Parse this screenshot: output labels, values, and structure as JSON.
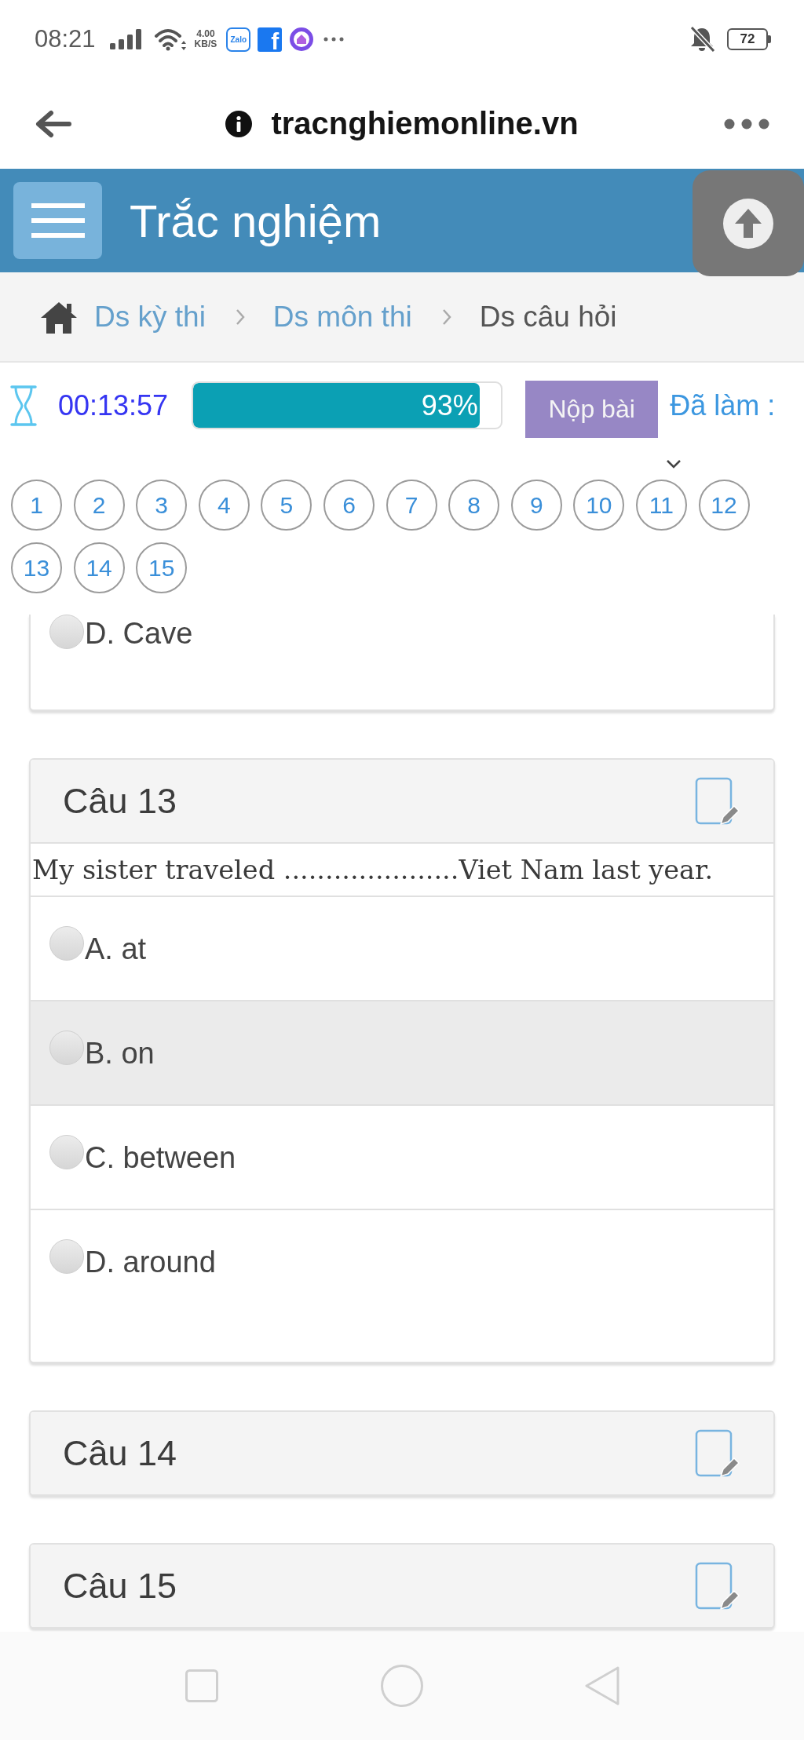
{
  "status_bar": {
    "time": "08:21",
    "speed": {
      "value": "4.00",
      "unit": "KB/S"
    },
    "notifications": [
      {
        "kind": "chat",
        "label": "Zalo"
      },
      {
        "kind": "social",
        "label": "f"
      },
      {
        "kind": "ring"
      }
    ],
    "battery": "72"
  },
  "browser": {
    "url": "tracnghiemonline.vn"
  },
  "header": {
    "title": "Trắc nghiệm"
  },
  "breadcrumb": [
    {
      "label": "Ds kỳ thi",
      "current": false
    },
    {
      "label": "Ds môn thi",
      "current": false
    },
    {
      "label": "Ds câu hỏi",
      "current": true
    }
  ],
  "exam_bar": {
    "timer": "00:13:57",
    "progress": {
      "level": 0.93,
      "reading": "93%"
    },
    "submit_button": "Nộp bài",
    "answered_label": "Đã làm :"
  },
  "question_numbers": [
    "1",
    "2",
    "3",
    "4",
    "5",
    "6",
    "7",
    "8",
    "9",
    "10",
    "11",
    "12",
    "13",
    "14",
    "15"
  ],
  "partial_question": {
    "options": [
      {
        "label": "D. Cave",
        "selected": false,
        "highlighted": false
      }
    ]
  },
  "questions": [
    {
      "title": "Câu 13",
      "expanded": true,
      "text": "My sister traveled .....................Viet Nam last year.",
      "options": [
        {
          "label": "A. at",
          "selected": false,
          "highlighted": false
        },
        {
          "label": "B. on",
          "selected": false,
          "highlighted": true
        },
        {
          "label": "C. between",
          "selected": false,
          "highlighted": false
        },
        {
          "label": "D. around",
          "selected": false,
          "highlighted": false
        }
      ]
    },
    {
      "title": "Câu 14",
      "expanded": false
    },
    {
      "title": "Câu 15",
      "expanded": false
    }
  ]
}
